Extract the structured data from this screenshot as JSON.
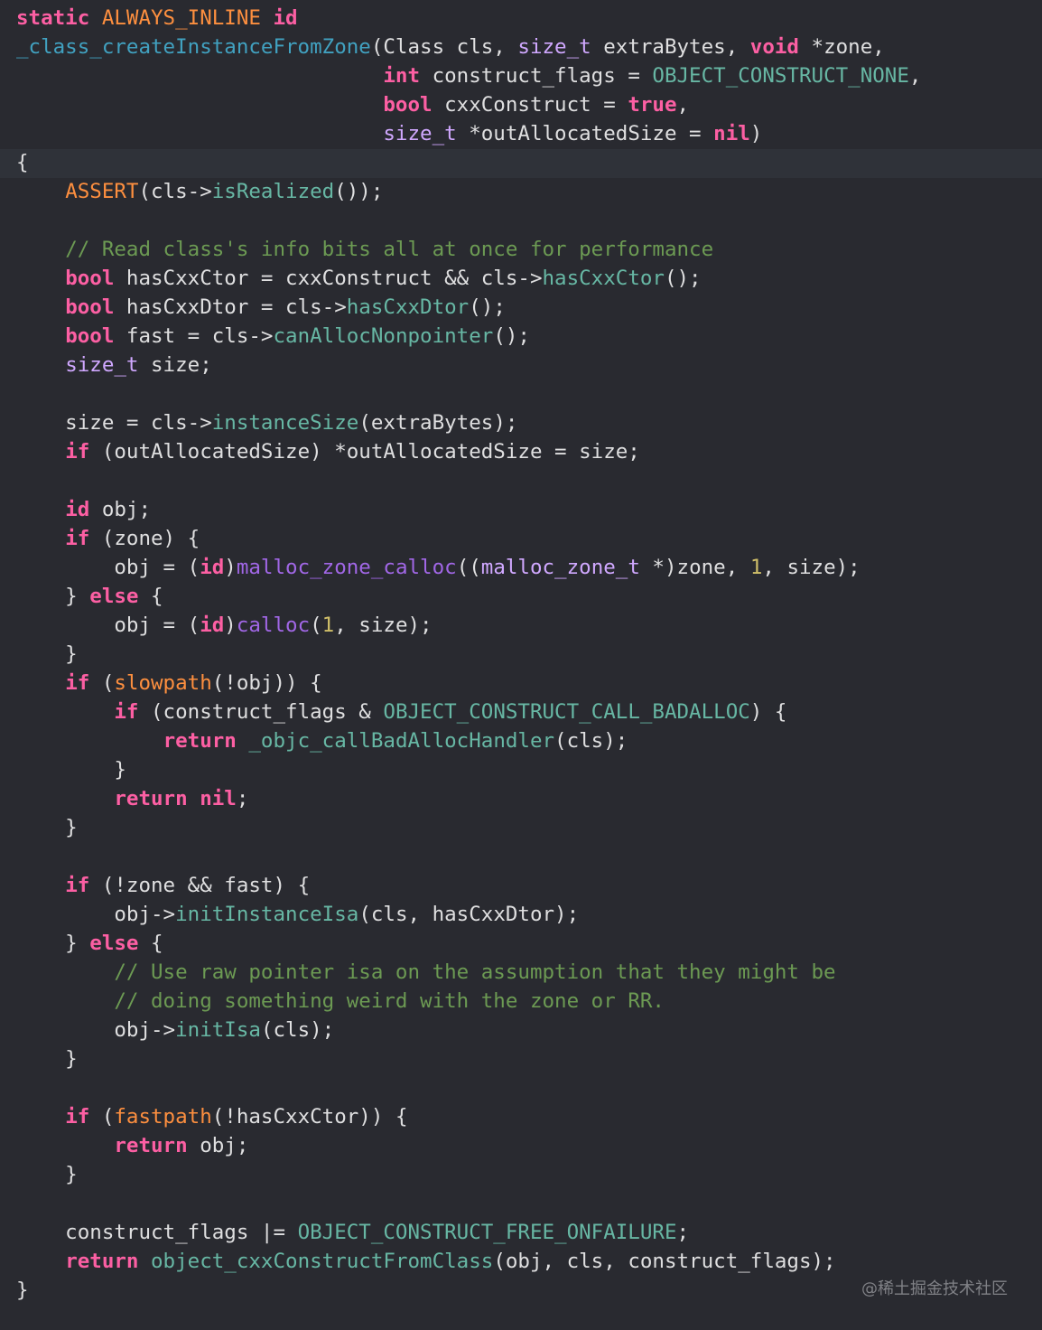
{
  "editor": {
    "language": "objective-c",
    "theme": "dark",
    "highlighted_line": 6,
    "colors": {
      "background": "#292a30",
      "current_line": "#2f3239",
      "plain": "#dfdfe0",
      "keyword": "#fc5fa3",
      "type": "#d0a8ff",
      "macro": "#fd8f3f",
      "function": "#67b7a4",
      "constant": "#67b7a4",
      "library_function": "#a167e6",
      "comment": "#6c9a53",
      "number": "#d0bf69",
      "declaration": "#41a1c0"
    },
    "lines": [
      {
        "n": 1,
        "tokens": [
          [
            "kw",
            "static"
          ],
          [
            "plain",
            " "
          ],
          [
            "macro",
            "ALWAYS_INLINE"
          ],
          [
            "plain",
            " "
          ],
          [
            "kw",
            "id"
          ]
        ]
      },
      {
        "n": 2,
        "tokens": [
          [
            "decl",
            "_class_createInstanceFromZone"
          ],
          [
            "plain",
            "(Class cls, "
          ],
          [
            "type",
            "size_t"
          ],
          [
            "plain",
            " extraBytes, "
          ],
          [
            "kw",
            "void"
          ],
          [
            "plain",
            " *zone,"
          ]
        ]
      },
      {
        "n": 3,
        "tokens": [
          [
            "plain",
            "                              "
          ],
          [
            "kw",
            "int"
          ],
          [
            "plain",
            " construct_flags = "
          ],
          [
            "const",
            "OBJECT_CONSTRUCT_NONE"
          ],
          [
            "plain",
            ","
          ]
        ]
      },
      {
        "n": 4,
        "tokens": [
          [
            "plain",
            "                              "
          ],
          [
            "kw",
            "bool"
          ],
          [
            "plain",
            " cxxConstruct = "
          ],
          [
            "kw",
            "true"
          ],
          [
            "plain",
            ","
          ]
        ]
      },
      {
        "n": 5,
        "tokens": [
          [
            "plain",
            "                              "
          ],
          [
            "type",
            "size_t"
          ],
          [
            "plain",
            " *outAllocatedSize = "
          ],
          [
            "kw",
            "nil"
          ],
          [
            "plain",
            ")"
          ]
        ]
      },
      {
        "n": 6,
        "tokens": [
          [
            "plain",
            "{"
          ]
        ]
      },
      {
        "n": 7,
        "tokens": [
          [
            "plain",
            "    "
          ],
          [
            "macro",
            "ASSERT"
          ],
          [
            "plain",
            "(cls->"
          ],
          [
            "func",
            "isRealized"
          ],
          [
            "plain",
            "());"
          ]
        ]
      },
      {
        "n": 8,
        "tokens": []
      },
      {
        "n": 9,
        "tokens": [
          [
            "plain",
            "    "
          ],
          [
            "comment",
            "// Read class's info bits all at once for performance"
          ]
        ]
      },
      {
        "n": 10,
        "tokens": [
          [
            "plain",
            "    "
          ],
          [
            "kw",
            "bool"
          ],
          [
            "plain",
            " hasCxxCtor = cxxConstruct && cls->"
          ],
          [
            "func",
            "hasCxxCtor"
          ],
          [
            "plain",
            "();"
          ]
        ]
      },
      {
        "n": 11,
        "tokens": [
          [
            "plain",
            "    "
          ],
          [
            "kw",
            "bool"
          ],
          [
            "plain",
            " hasCxxDtor = cls->"
          ],
          [
            "func",
            "hasCxxDtor"
          ],
          [
            "plain",
            "();"
          ]
        ]
      },
      {
        "n": 12,
        "tokens": [
          [
            "plain",
            "    "
          ],
          [
            "kw",
            "bool"
          ],
          [
            "plain",
            " fast = cls->"
          ],
          [
            "func",
            "canAllocNonpointer"
          ],
          [
            "plain",
            "();"
          ]
        ]
      },
      {
        "n": 13,
        "tokens": [
          [
            "plain",
            "    "
          ],
          [
            "type",
            "size_t"
          ],
          [
            "plain",
            " size;"
          ]
        ]
      },
      {
        "n": 14,
        "tokens": []
      },
      {
        "n": 15,
        "tokens": [
          [
            "plain",
            "    size = cls->"
          ],
          [
            "func",
            "instanceSize"
          ],
          [
            "plain",
            "(extraBytes);"
          ]
        ]
      },
      {
        "n": 16,
        "tokens": [
          [
            "plain",
            "    "
          ],
          [
            "kw",
            "if"
          ],
          [
            "plain",
            " (outAllocatedSize) *outAllocatedSize = size;"
          ]
        ]
      },
      {
        "n": 17,
        "tokens": []
      },
      {
        "n": 18,
        "tokens": [
          [
            "plain",
            "    "
          ],
          [
            "kw",
            "id"
          ],
          [
            "plain",
            " obj;"
          ]
        ]
      },
      {
        "n": 19,
        "tokens": [
          [
            "plain",
            "    "
          ],
          [
            "kw",
            "if"
          ],
          [
            "plain",
            " (zone) {"
          ]
        ]
      },
      {
        "n": 20,
        "tokens": [
          [
            "plain",
            "        obj = ("
          ],
          [
            "kw",
            "id"
          ],
          [
            "plain",
            ")"
          ],
          [
            "libfn",
            "malloc_zone_calloc"
          ],
          [
            "plain",
            "(("
          ],
          [
            "type",
            "malloc_zone_t"
          ],
          [
            "plain",
            " *)zone, "
          ],
          [
            "num",
            "1"
          ],
          [
            "plain",
            ", size);"
          ]
        ]
      },
      {
        "n": 21,
        "tokens": [
          [
            "plain",
            "    } "
          ],
          [
            "kw",
            "else"
          ],
          [
            "plain",
            " {"
          ]
        ]
      },
      {
        "n": 22,
        "tokens": [
          [
            "plain",
            "        obj = ("
          ],
          [
            "kw",
            "id"
          ],
          [
            "plain",
            ")"
          ],
          [
            "libfn",
            "calloc"
          ],
          [
            "plain",
            "("
          ],
          [
            "num",
            "1"
          ],
          [
            "plain",
            ", size);"
          ]
        ]
      },
      {
        "n": 23,
        "tokens": [
          [
            "plain",
            "    }"
          ]
        ]
      },
      {
        "n": 24,
        "tokens": [
          [
            "plain",
            "    "
          ],
          [
            "kw",
            "if"
          ],
          [
            "plain",
            " ("
          ],
          [
            "macro",
            "slowpath"
          ],
          [
            "plain",
            "(!obj)) {"
          ]
        ]
      },
      {
        "n": 25,
        "tokens": [
          [
            "plain",
            "        "
          ],
          [
            "kw",
            "if"
          ],
          [
            "plain",
            " (construct_flags & "
          ],
          [
            "const",
            "OBJECT_CONSTRUCT_CALL_BADALLOC"
          ],
          [
            "plain",
            ") {"
          ]
        ]
      },
      {
        "n": 26,
        "tokens": [
          [
            "plain",
            "            "
          ],
          [
            "kw",
            "return"
          ],
          [
            "plain",
            " "
          ],
          [
            "func",
            "_objc_callBadAllocHandler"
          ],
          [
            "plain",
            "(cls);"
          ]
        ]
      },
      {
        "n": 27,
        "tokens": [
          [
            "plain",
            "        }"
          ]
        ]
      },
      {
        "n": 28,
        "tokens": [
          [
            "plain",
            "        "
          ],
          [
            "kw",
            "return"
          ],
          [
            "plain",
            " "
          ],
          [
            "kw",
            "nil"
          ],
          [
            "plain",
            ";"
          ]
        ]
      },
      {
        "n": 29,
        "tokens": [
          [
            "plain",
            "    }"
          ]
        ]
      },
      {
        "n": 30,
        "tokens": []
      },
      {
        "n": 31,
        "tokens": [
          [
            "plain",
            "    "
          ],
          [
            "kw",
            "if"
          ],
          [
            "plain",
            " (!zone && fast) {"
          ]
        ]
      },
      {
        "n": 32,
        "tokens": [
          [
            "plain",
            "        obj->"
          ],
          [
            "func",
            "initInstanceIsa"
          ],
          [
            "plain",
            "(cls, hasCxxDtor);"
          ]
        ]
      },
      {
        "n": 33,
        "tokens": [
          [
            "plain",
            "    } "
          ],
          [
            "kw",
            "else"
          ],
          [
            "plain",
            " {"
          ]
        ]
      },
      {
        "n": 34,
        "tokens": [
          [
            "plain",
            "        "
          ],
          [
            "comment",
            "// Use raw pointer isa on the assumption that they might be"
          ]
        ]
      },
      {
        "n": 35,
        "tokens": [
          [
            "plain",
            "        "
          ],
          [
            "comment",
            "// doing something weird with the zone or RR."
          ]
        ]
      },
      {
        "n": 36,
        "tokens": [
          [
            "plain",
            "        obj->"
          ],
          [
            "func",
            "initIsa"
          ],
          [
            "plain",
            "(cls);"
          ]
        ]
      },
      {
        "n": 37,
        "tokens": [
          [
            "plain",
            "    }"
          ]
        ]
      },
      {
        "n": 38,
        "tokens": []
      },
      {
        "n": 39,
        "tokens": [
          [
            "plain",
            "    "
          ],
          [
            "kw",
            "if"
          ],
          [
            "plain",
            " ("
          ],
          [
            "macro",
            "fastpath"
          ],
          [
            "plain",
            "(!hasCxxCtor)) {"
          ]
        ]
      },
      {
        "n": 40,
        "tokens": [
          [
            "plain",
            "        "
          ],
          [
            "kw",
            "return"
          ],
          [
            "plain",
            " obj;"
          ]
        ]
      },
      {
        "n": 41,
        "tokens": [
          [
            "plain",
            "    }"
          ]
        ]
      },
      {
        "n": 42,
        "tokens": []
      },
      {
        "n": 43,
        "tokens": [
          [
            "plain",
            "    construct_flags |= "
          ],
          [
            "const",
            "OBJECT_CONSTRUCT_FREE_ONFAILURE"
          ],
          [
            "plain",
            ";"
          ]
        ]
      },
      {
        "n": 44,
        "tokens": [
          [
            "plain",
            "    "
          ],
          [
            "kw",
            "return"
          ],
          [
            "plain",
            " "
          ],
          [
            "func",
            "object_cxxConstructFromClass"
          ],
          [
            "plain",
            "(obj, cls, construct_flags);"
          ]
        ]
      },
      {
        "n": 45,
        "tokens": [
          [
            "plain",
            "}"
          ]
        ]
      }
    ]
  },
  "watermark": "@稀土掘金技术社区"
}
